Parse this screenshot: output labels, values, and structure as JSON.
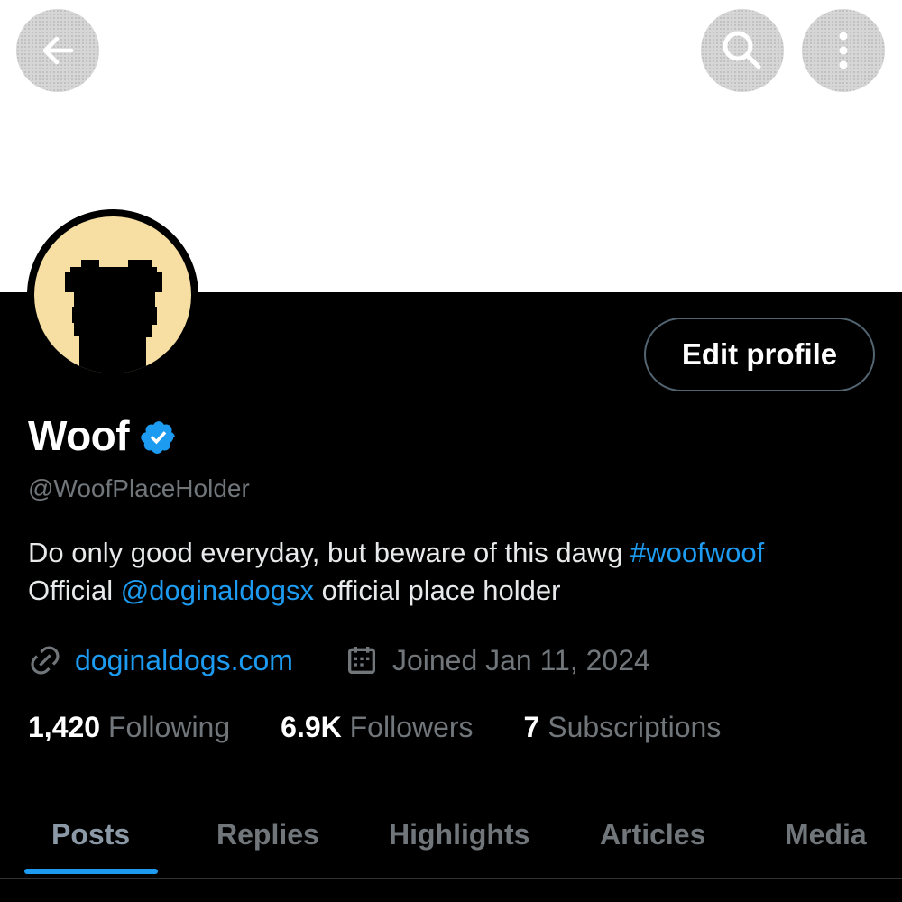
{
  "header": {
    "back_icon": "back-arrow-icon",
    "search_icon": "search-icon",
    "more_icon": "more-vertical-icon"
  },
  "profile": {
    "display_name": "Woof",
    "verified": true,
    "handle": "@WoofPlaceHolder",
    "edit_label": "Edit profile",
    "avatar_color": "#f7dfa4",
    "bio": {
      "line1_text": "Do only good everyday, but beware of this dawg ",
      "line1_hashtag": "#woofwoof",
      "line2_prefix": "Official ",
      "line2_mention": "@doginaldogsx",
      "line2_suffix": " official place holder"
    },
    "website": "doginaldogs.com",
    "joined": "Joined Jan 11, 2024"
  },
  "stats": [
    {
      "value": "1,420",
      "label": "Following"
    },
    {
      "value": "6.9K",
      "label": "Followers"
    },
    {
      "value": "7",
      "label": "Subscriptions"
    }
  ],
  "tabs": [
    {
      "label": "Posts",
      "active": true
    },
    {
      "label": "Replies",
      "active": false
    },
    {
      "label": "Highlights",
      "active": false
    },
    {
      "label": "Articles",
      "active": false
    },
    {
      "label": "Media",
      "active": false
    }
  ],
  "colors": {
    "accent": "#1d9bf0",
    "muted": "#71767b",
    "background": "#000000",
    "banner": "#ffffff"
  }
}
